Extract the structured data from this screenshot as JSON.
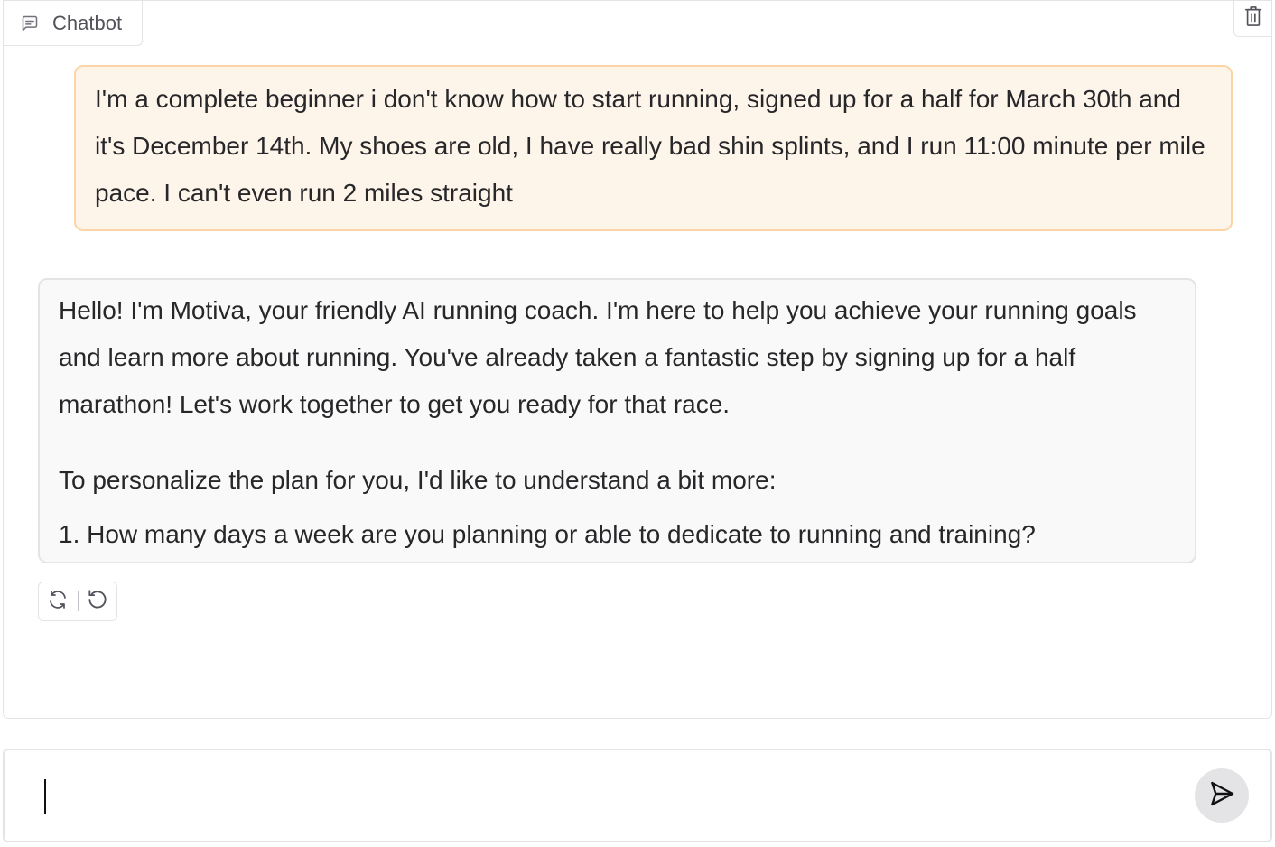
{
  "chatbot": {
    "label": "Chatbot",
    "label_icon": "chat-bubble-icon",
    "clear_icon": "trash-icon"
  },
  "messages": {
    "user": {
      "text": "I'm a complete beginner i don't know how to start running, signed up for a half for March 30th and it's December 14th. My shoes are old, I have really bad shin splints, and I run 11:00 minute per mile pace. I can't even run 2 miles straight"
    },
    "bot": {
      "paragraph1": "Hello! I'm Motiva, your friendly AI running coach. I'm here to help you achieve your running goals and learn more about running. You've already taken a fantastic step by signing up for a half marathon! Let's work together to get you ready for that race.",
      "paragraph2": "To personalize the plan for you, I'd like to understand a bit more:",
      "paragraph3": "1. How many days a week are you planning or able to dedicate to running and training?"
    }
  },
  "actions": {
    "retry_icon": "retry-icon",
    "undo_icon": "undo-icon"
  },
  "input": {
    "value": "",
    "placeholder": "",
    "send_icon": "send-icon"
  },
  "colors": {
    "user_bubble_bg": "#fdf4ea",
    "user_bubble_border": "#fbd5a5",
    "bot_bubble_bg": "#f9f9f9",
    "send_button_bg": "#e4e4e7"
  }
}
